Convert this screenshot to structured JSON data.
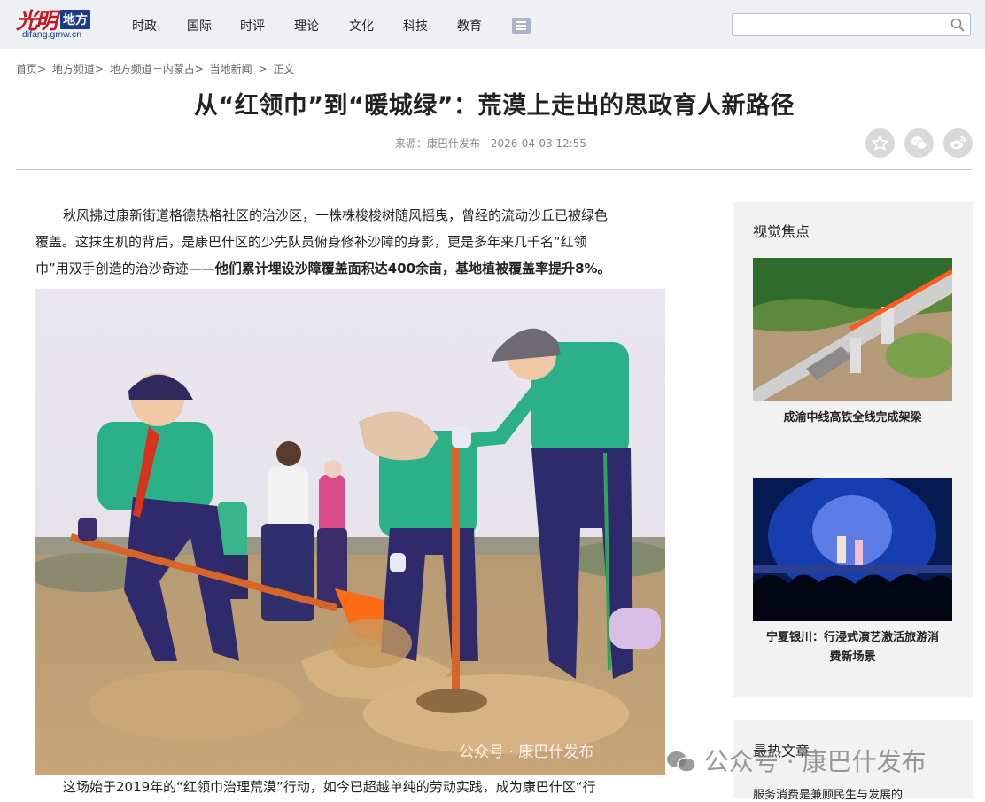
{
  "logo": {
    "brush": "光明",
    "tag": "地方",
    "url": "difang.gmw.cn"
  },
  "nav": [
    "时政",
    "国际",
    "时评",
    "理论",
    "文化",
    "科技",
    "教育"
  ],
  "search": {
    "placeholder": ""
  },
  "breadcrumb": [
    "首页>",
    "地方频道>",
    "地方频道－内蒙古>",
    "当地新闻",
    ">",
    "正文"
  ],
  "article": {
    "title": "从“红领巾”到“暖城绿”：荒漠上走出的思政育人新路径",
    "source": "来源：康巴什发布",
    "datetime": "2026-04-03 12:55",
    "intro_line1": "秋风拂过康新街道格德热格社区的治沙区，一株株梭梭树随风摇曳，曾经的流动沙丘已被绿色",
    "intro_line2": "覆盖。这抹生机的背后，是康巴什区的少先队员俯身修补沙障的身影，更是多年来几千名“红领",
    "intro_line3_plain": "巾”用双手创造的治沙奇迹——",
    "intro_line3_bold": "他们累计埋设沙障覆盖面积达400余亩，基地植被覆盖率提升8%。",
    "photo_watermark": "公众号 · 康巴什发布",
    "next_para": "这场始于2019年的“红领巾治理荒漠”行动，如今已超越单纯的劳动实践，成为康巴什区“行"
  },
  "sidebar": {
    "section_title": "视觉焦点",
    "items": [
      {
        "caption": "成渝中线高铁全线完成架梁"
      },
      {
        "caption_line1": "宁夏银川：行浸式演艺激活旅游消",
        "caption_line2": "费新场景"
      }
    ],
    "hot_title": "最热文章",
    "hot_item": "服务消费是兼顾民生与发展的"
  },
  "page_watermark": "公众号 · 康巴什发布",
  "colors": {
    "brand_red": "#c8161d",
    "brand_blue": "#1d3b8a",
    "header_bg": "#eef1f4",
    "sidebar_bg": "#f2f2f2"
  }
}
